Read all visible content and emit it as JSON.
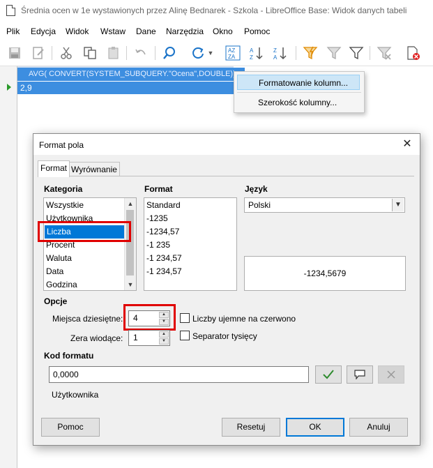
{
  "window": {
    "title": "Średnia ocen w 1e wystawionych przez Alinę Bednarek - Szkola - LibreOffice Base: Widok danych tabeli"
  },
  "menubar": {
    "items": [
      {
        "label": "Plik"
      },
      {
        "label": "Edycja"
      },
      {
        "label": "Widok"
      },
      {
        "label": "Wstaw"
      },
      {
        "label": "Dane"
      },
      {
        "label": "Narzędzia"
      },
      {
        "label": "Okno"
      },
      {
        "label": "Pomoc"
      }
    ]
  },
  "grid": {
    "column_header": "AVG( CONVERT(SYSTEM_SUBQUERY.\"Ocena\",DOUBLE))",
    "rows": [
      {
        "value": "2,9"
      }
    ]
  },
  "context_menu": {
    "items": [
      {
        "label": "Formatowanie kolumn..."
      },
      {
        "label": "Szerokość kolumny..."
      }
    ]
  },
  "dialog": {
    "title": "Format pola",
    "close_symbol": "✕",
    "tabs": [
      {
        "label": "Format"
      },
      {
        "label": "Wyrównanie"
      }
    ],
    "category": {
      "label": "Kategoria",
      "items": [
        "Wszystkie",
        "Użytkownika",
        "Liczba",
        "Procent",
        "Waluta",
        "Data",
        "Godzina"
      ],
      "selected": "Liczba"
    },
    "format": {
      "label": "Format",
      "items": [
        "Standard",
        "-1235",
        "-1234,57",
        "-1 235",
        "-1 234,57",
        "-1 234,57"
      ]
    },
    "language": {
      "label": "Język",
      "value": "Polski"
    },
    "preview": "-1234,5679",
    "options": {
      "label": "Opcje",
      "decimal_places_label": "Miejsca dziesiętne:",
      "decimal_places_value": "4",
      "leading_zeros_label": "Zera wiodące:",
      "leading_zeros_value": "1",
      "negative_red_label": "Liczby ujemne na czerwono",
      "negative_red_checked": false,
      "thousands_sep_label": "Separator tysięcy",
      "thousands_sep_checked": false
    },
    "format_code": {
      "label": "Kod formatu",
      "value": "0,0000",
      "description": "Użytkownika"
    },
    "buttons": {
      "help": "Pomoc",
      "reset": "Resetuj",
      "ok": "OK",
      "cancel": "Anuluj"
    }
  },
  "colors": {
    "selection": "#0078d7",
    "grid_selection": "#3d8ee0",
    "highlight_box": "#e00000",
    "ok_check": "#2e8b2e"
  }
}
